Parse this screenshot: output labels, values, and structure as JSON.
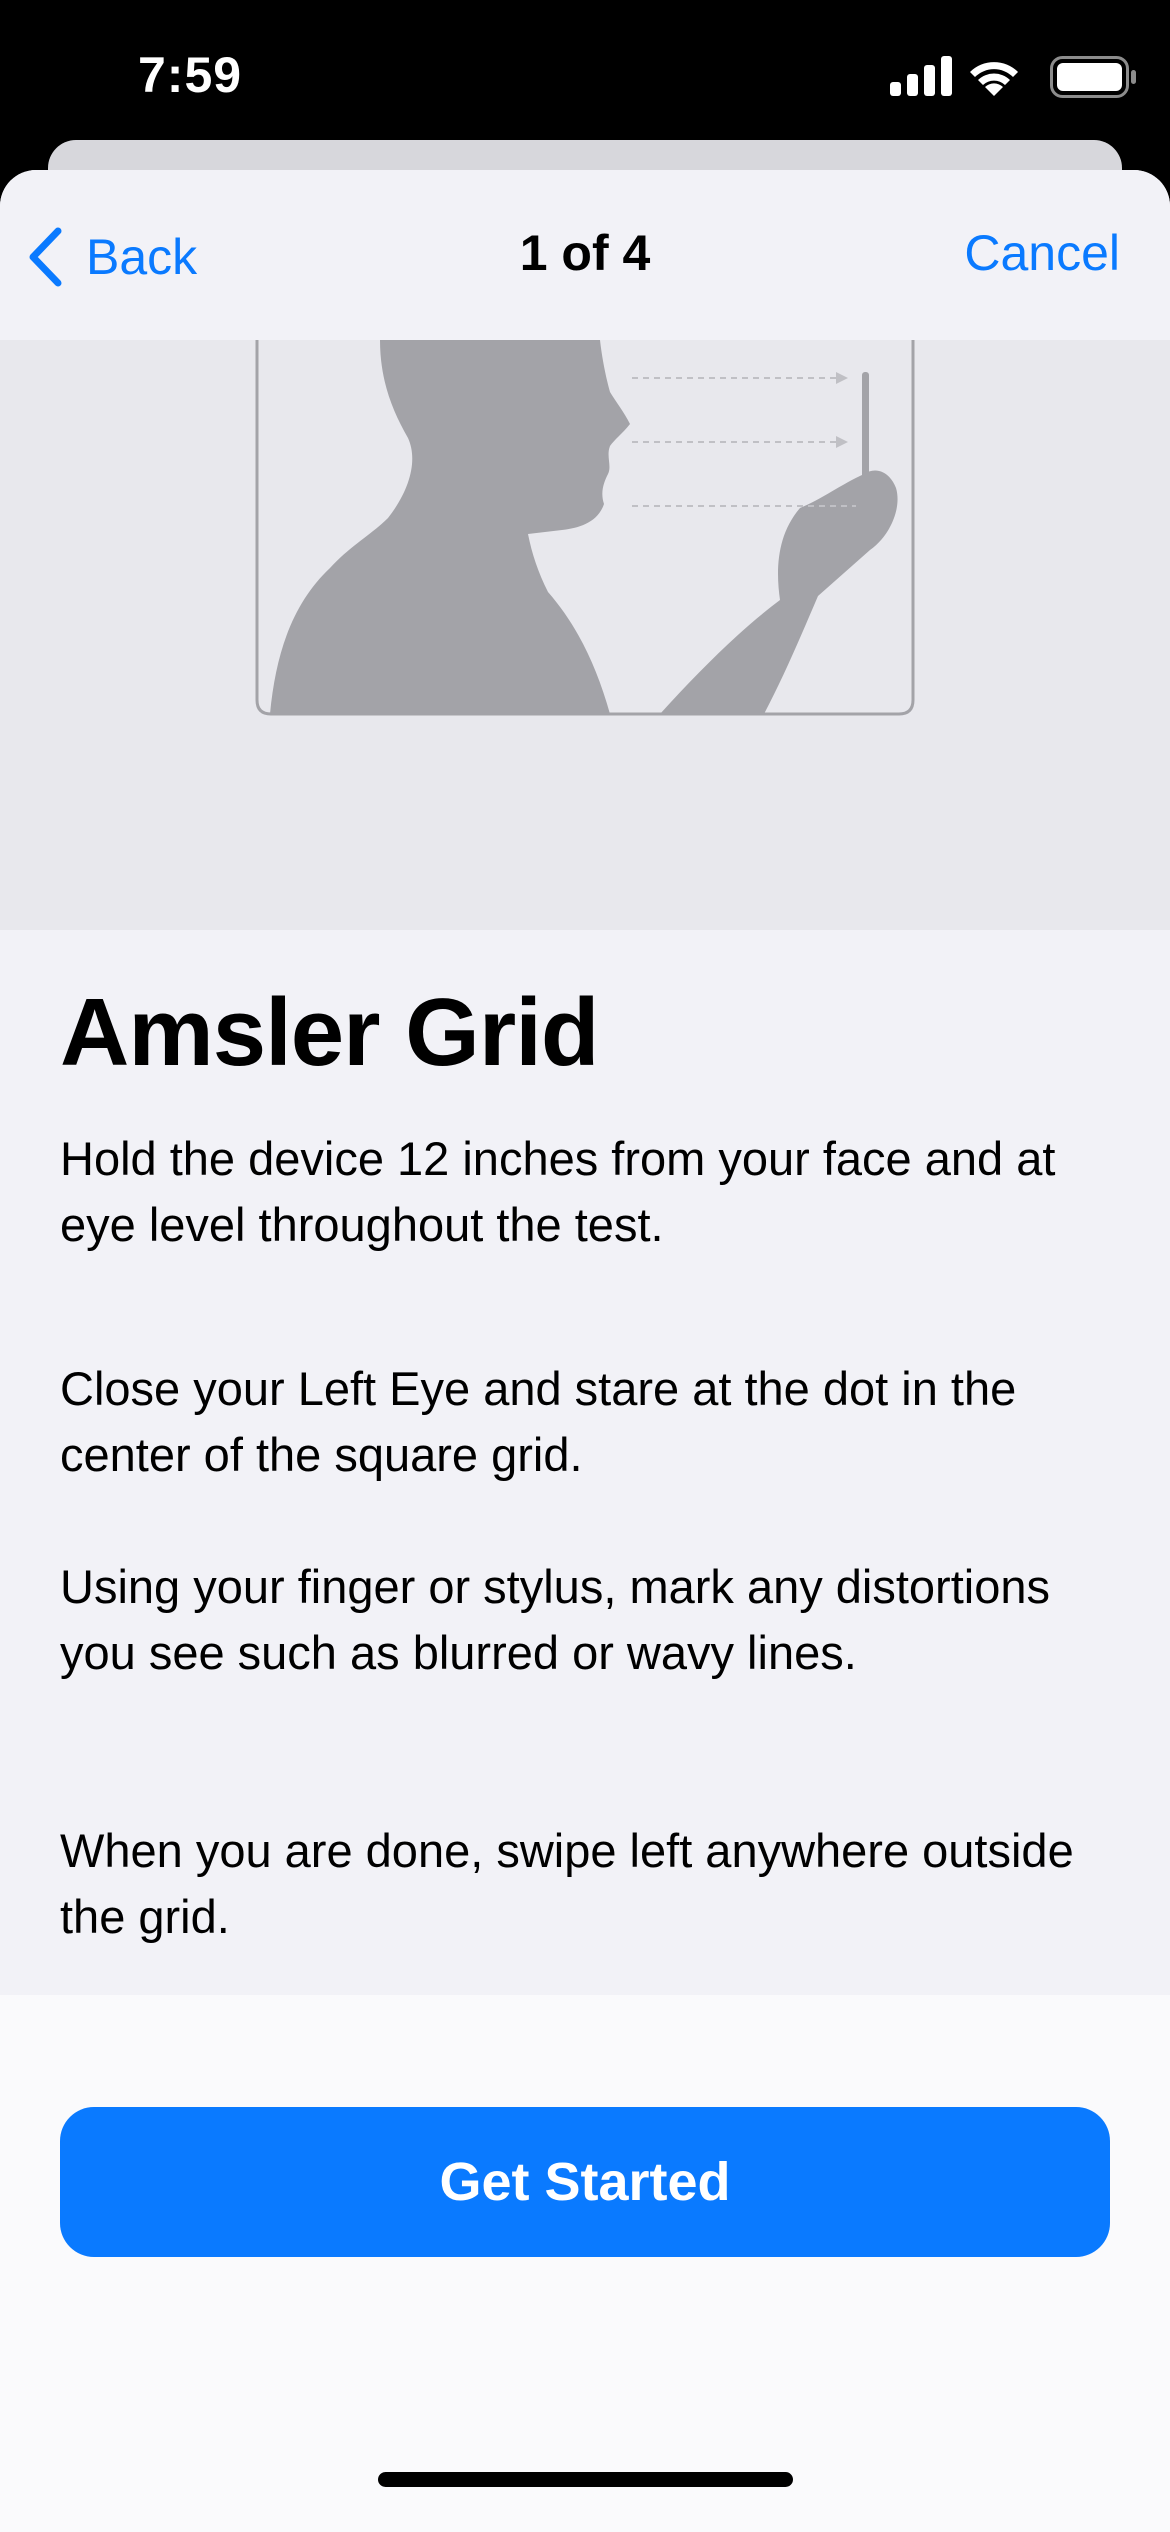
{
  "status_bar": {
    "time": "7:59"
  },
  "nav": {
    "back_label": "Back",
    "title": "1 of 4",
    "cancel_label": "Cancel"
  },
  "content": {
    "title": "Amsler Grid",
    "paragraphs": [
      "Hold the device 12 inches from your face and at eye level throughout the test.",
      "Close your Left Eye and stare at the dot in the center of the square grid.",
      "Using your finger or stylus, mark any distortions you see such as blurred or wavy lines.",
      "When you are done, swipe left anywhere outside the grid."
    ]
  },
  "cta": {
    "label": "Get Started"
  },
  "icons": {
    "signal": "cellular-signal-icon",
    "wifi": "wifi-icon",
    "battery": "battery-icon",
    "back": "chevron-left-icon",
    "illustration": "person-holding-device-illustration"
  },
  "colors": {
    "accent": "#0a7aff",
    "background": "#f2f2f7",
    "hero_background": "#e8e8ed",
    "silhouette": "#a3a3a8"
  }
}
